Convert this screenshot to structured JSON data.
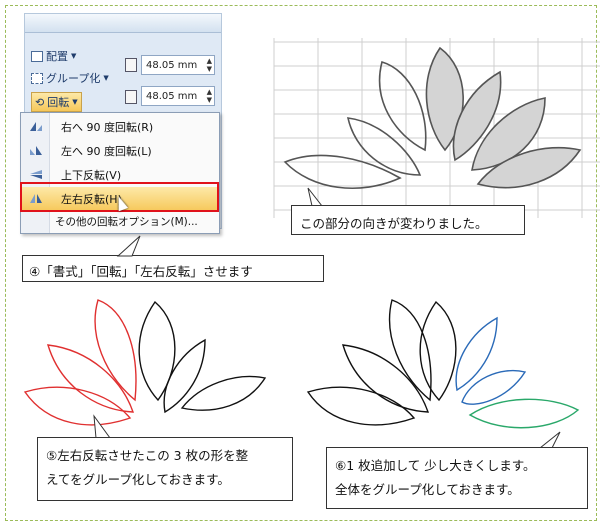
{
  "ribbon": {
    "arrange_label": "配置",
    "group_label": "グループ化",
    "rotate_label": "回転",
    "height_value": "48.05 mm",
    "width_value": "48.05 mm"
  },
  "rotate_menu": {
    "items": [
      {
        "label": "右へ 90 度回転(R)"
      },
      {
        "label": "左へ 90 度回転(L)"
      },
      {
        "label": "上下反転(V)"
      },
      {
        "label": "左右反転(H)"
      },
      {
        "label": "その他の回転オプション(M)..."
      }
    ],
    "selected_index": 3
  },
  "callouts": {
    "step4": "④「書式」「回転」「左右反転」させます",
    "direction_changed": "この部分の向きが変わりました。",
    "step5_line1": "⑤左右反転させたこの 3 枚の形を整",
    "step5_line2": "えてをグループ化しておきます。",
    "step6_line1": "⑥1 枚追加して  少し大きくします。",
    "step6_line2": "全体をグループ化しておきます。"
  },
  "colors": {
    "frame": "#9bbb59",
    "highlight_box": "#e0121b",
    "petal_red": "#e03030",
    "petal_blue": "#2a6ab8",
    "petal_green": "#2aa86a",
    "petal_fill": "#d4d4d4"
  }
}
